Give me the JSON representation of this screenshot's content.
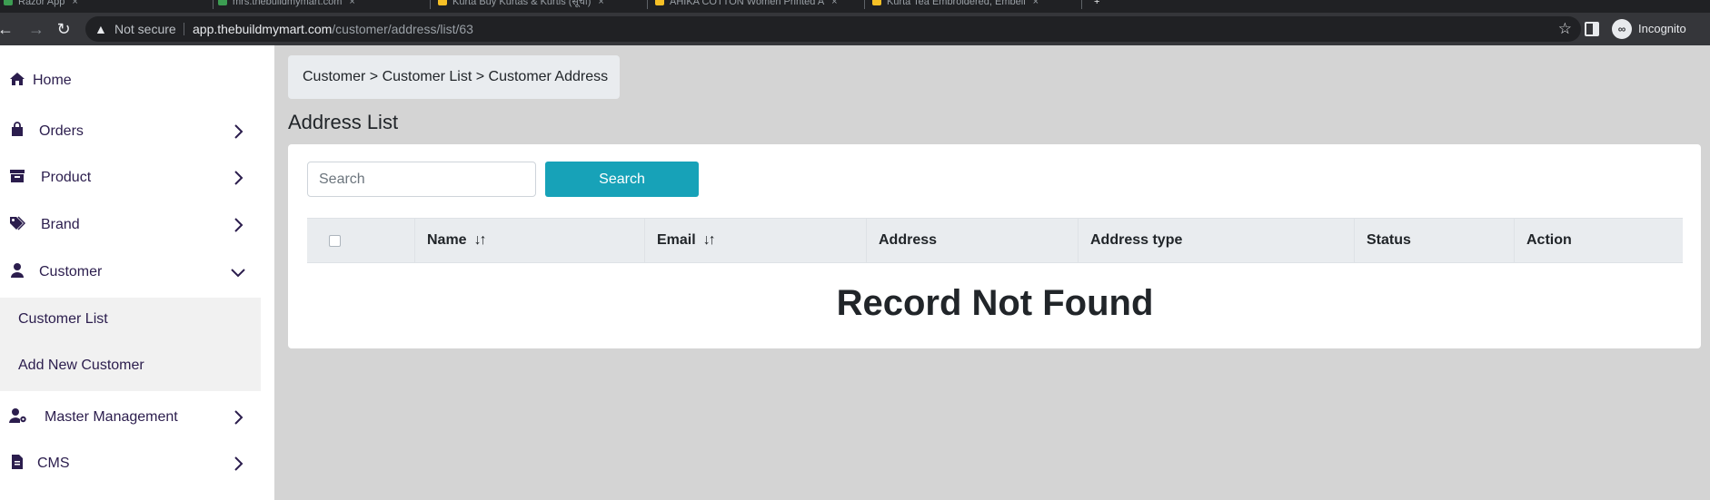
{
  "browser": {
    "tabs": [
      {
        "label": "Razor App"
      },
      {
        "label": "mrs.thebuildmymart.com"
      },
      {
        "label": "Kurta Buy Kurtas & Kurtis (सूची)"
      },
      {
        "label": "AHIKA COTTON Women Printed A"
      },
      {
        "label": "Kurta Tea Embroidered, Embell"
      }
    ],
    "security_label": "Not secure",
    "url_host": "app.thebuildmymart.com",
    "url_path": "/customer/address/list/63",
    "profile_label": "Incognito"
  },
  "sidebar": {
    "items": [
      {
        "label": "Home",
        "icon": "home-icon"
      },
      {
        "label": "Orders",
        "icon": "shopping-bag-icon"
      },
      {
        "label": "Product",
        "icon": "archive-box-icon"
      },
      {
        "label": "Brand",
        "icon": "tags-icon"
      },
      {
        "label": "Customer",
        "icon": "user-icon"
      },
      {
        "label": "Master Management",
        "icon": "user-gear-icon"
      },
      {
        "label": "CMS",
        "icon": "file-icon"
      }
    ],
    "customer_submenu": [
      {
        "label": "Customer List"
      },
      {
        "label": "Add New Customer"
      }
    ]
  },
  "main": {
    "breadcrumb": "Customer > Customer List > Customer Address",
    "title": "Address List",
    "search": {
      "placeholder": "Search",
      "value": "",
      "button_label": "Search"
    },
    "table": {
      "columns": [
        "",
        "Name",
        "Email",
        "Address",
        "Address type",
        "Status",
        "Action"
      ],
      "sortable": [
        "Name",
        "Email"
      ],
      "sort_glyph": "↓↑",
      "rows": [],
      "empty_message": "Record Not Found"
    }
  },
  "colors": {
    "page_bg": "#d4d4d4",
    "sidebar_text": "#2b1d4d",
    "search_button": "#17a2b8",
    "table_header_bg": "#e9ecef"
  }
}
